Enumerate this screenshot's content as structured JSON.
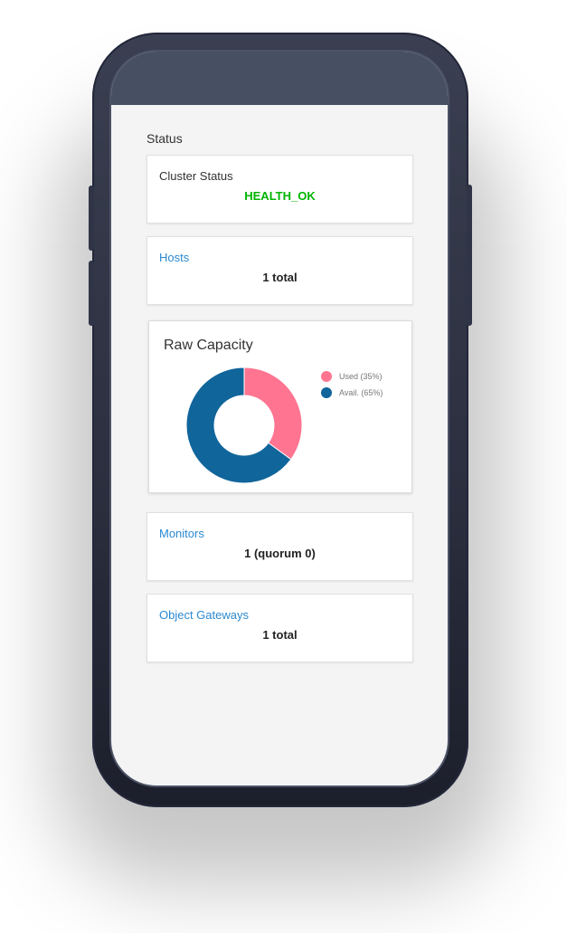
{
  "status": {
    "title": "Status",
    "cluster": {
      "label": "Cluster Status",
      "value": "HEALTH_OK"
    },
    "hosts": {
      "label": "Hosts",
      "value": "1 total"
    },
    "monitors": {
      "label": "Monitors",
      "value": "1 (quorum 0)"
    },
    "gateways": {
      "label": "Object Gateways",
      "value": "1 total"
    }
  },
  "colors": {
    "ok": "#00b400",
    "link": "#2b8ad1",
    "used": "#ff7591",
    "avail": "#10659b"
  },
  "chart_data": {
    "type": "pie",
    "title": "Raw Capacity",
    "categories": [
      "Used (35%)",
      "Avail. (65%)"
    ],
    "values": [
      35,
      65
    ],
    "colors": [
      "#ff7591",
      "#10659b"
    ],
    "legend": "right",
    "donut": true
  }
}
